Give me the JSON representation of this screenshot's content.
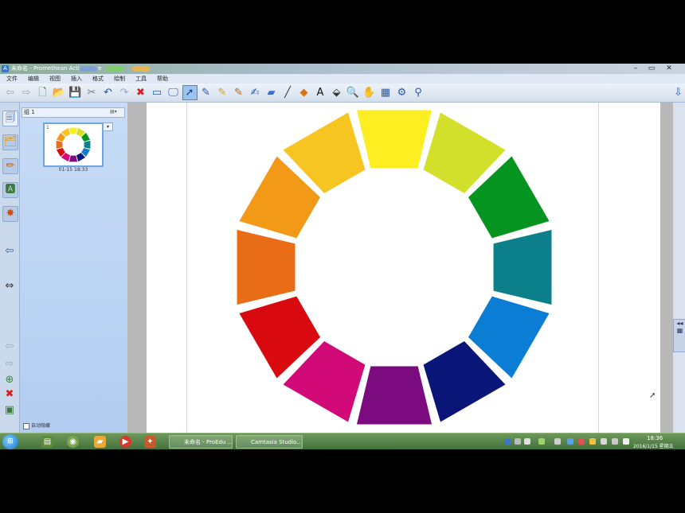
{
  "window": {
    "title": "未命名 - Promethean ActivInspire"
  },
  "menu": [
    "文件",
    "编辑",
    "视图",
    "插入",
    "格式",
    "绘制",
    "工具",
    "帮助"
  ],
  "toolbar": {
    "tools": [
      {
        "icon": "back-arrow-icon",
        "glyph": "⇦"
      },
      {
        "icon": "forward-arrow-icon",
        "glyph": "⇨"
      },
      {
        "icon": "new-page-icon",
        "glyph": "🗋"
      },
      {
        "icon": "open-folder-icon",
        "glyph": "📂"
      },
      {
        "icon": "save-icon",
        "glyph": "💾"
      },
      {
        "icon": "cut-icon",
        "glyph": "✂"
      },
      {
        "icon": "undo-icon",
        "glyph": "↶"
      },
      {
        "icon": "redo-icon",
        "glyph": "↷"
      },
      {
        "icon": "delete-icon",
        "glyph": "✖"
      },
      {
        "icon": "screen-shade-icon",
        "glyph": "▭"
      },
      {
        "icon": "display-icon",
        "glyph": "🖵"
      },
      {
        "icon": "select-arrow-icon",
        "glyph": "➚"
      },
      {
        "icon": "pen-icon",
        "glyph": "✎"
      },
      {
        "icon": "highlighter-icon",
        "glyph": "✎"
      },
      {
        "icon": "magic-pen-icon",
        "glyph": "✎"
      },
      {
        "icon": "handwriting-icon",
        "glyph": "✍"
      },
      {
        "icon": "eraser-icon",
        "glyph": "▰"
      },
      {
        "icon": "line-icon",
        "glyph": "╱"
      },
      {
        "icon": "shape-icon",
        "glyph": "◆"
      },
      {
        "icon": "text-icon",
        "glyph": "A"
      },
      {
        "icon": "fill-icon",
        "glyph": "⬙"
      },
      {
        "icon": "magnifier-icon",
        "glyph": "🔍"
      },
      {
        "icon": "hand-icon",
        "glyph": "✋"
      },
      {
        "icon": "image-icon",
        "glyph": "▦"
      },
      {
        "icon": "settings-icon",
        "glyph": "⚙"
      },
      {
        "icon": "pin-icon",
        "glyph": "⚲"
      }
    ],
    "selected_index": 11,
    "collapse_glyph": "⇩"
  },
  "left_strip": [
    {
      "icon": "page-browser-icon",
      "glyph": "🗐"
    },
    {
      "icon": "resource-browser-icon",
      "glyph": "🗂"
    },
    {
      "icon": "object-browser-icon",
      "glyph": "✏"
    },
    {
      "icon": "notes-browser-icon",
      "glyph": "🅰"
    },
    {
      "icon": "property-browser-icon",
      "glyph": "✸"
    },
    {
      "icon": "dock-left-icon",
      "glyph": "⇦"
    },
    {
      "icon": "resize-icon",
      "glyph": "⇔"
    },
    {
      "icon": "nav-back-icon",
      "glyph": "⇦"
    },
    {
      "icon": "nav-forward-icon",
      "glyph": "⇨"
    },
    {
      "icon": "add-page-icon",
      "glyph": "⊕"
    },
    {
      "icon": "remove-page-icon",
      "glyph": "✖"
    },
    {
      "icon": "page-settings-icon",
      "glyph": "▣"
    }
  ],
  "page_panel": {
    "tab_label": "组 1",
    "page_number": "1",
    "thumb_label": "01-15 18:33",
    "auto_hide_label": "自动隐藏"
  },
  "color_wheel": {
    "segments": [
      "#fcee21",
      "#d2e02b",
      "#069421",
      "#0b7f8a",
      "#0b7dd4",
      "#0a1677",
      "#7b0b7e",
      "#d20a78",
      "#d80a10",
      "#e96c16",
      "#f29a17",
      "#f6c521"
    ]
  },
  "taskbar": {
    "buttons": [
      {
        "label": "未命名 - ProEdu ..."
      },
      {
        "label": "Camtasia Studio..."
      }
    ],
    "clock_time": "18:36",
    "clock_date": "2016/1/15 星期五"
  }
}
